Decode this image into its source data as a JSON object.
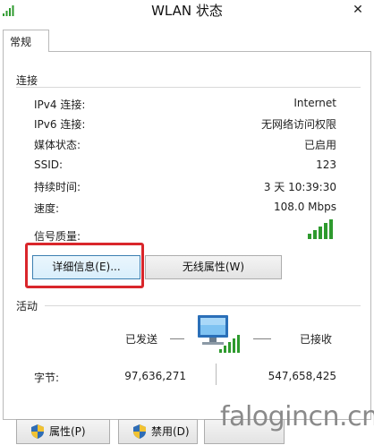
{
  "window": {
    "title": "WLAN 状态",
    "close_glyph": "✕"
  },
  "tabs": [
    {
      "label": "常规"
    }
  ],
  "connection": {
    "group_label": "连接",
    "rows": [
      {
        "label": "IPv4 连接:",
        "value": "Internet"
      },
      {
        "label": "IPv6 连接:",
        "value": "无网络访问权限"
      },
      {
        "label": "媒体状态:",
        "value": "已启用"
      },
      {
        "label": "SSID:",
        "value": "123"
      },
      {
        "label": "持续时间:",
        "value": "3 天 10:39:30"
      },
      {
        "label": "速度:",
        "value": "108.0 Mbps"
      }
    ],
    "signal_label": "信号质量:",
    "signal_bars": 5,
    "signal_bars_total": 5,
    "details_button": "详细信息(E)...",
    "wireless_button": "无线属性(W)"
  },
  "activity": {
    "group_label": "活动",
    "sent_label": "已发送",
    "received_label": "已接收",
    "bytes_label": "字节:",
    "bytes_sent": "97,636,271",
    "bytes_received": "547,658,425"
  },
  "bottom_buttons": {
    "properties": "属性(P)",
    "disable": "禁用(D)"
  },
  "watermark": "faloginсn.cn",
  "colors": {
    "signal_green": "#2e9a2e",
    "highlight_red": "#d9262b",
    "border": "#b9b9b9"
  },
  "icons": {
    "app": "wifi-signal-icon",
    "activity": "network-computer-icon",
    "shield": "uac-shield-icon"
  }
}
